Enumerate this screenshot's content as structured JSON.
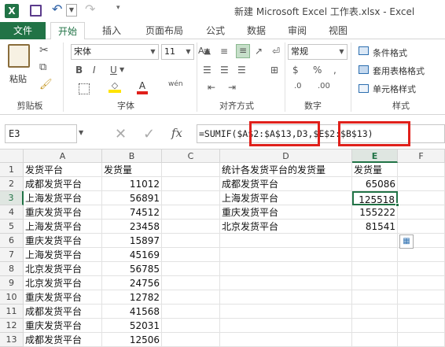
{
  "window": {
    "title": "新建 Microsoft Excel 工作表.xlsx - Excel",
    "app_icon": "excel-icon"
  },
  "tabs": [
    "文件",
    "开始",
    "插入",
    "页面布局",
    "公式",
    "数据",
    "审阅",
    "视图"
  ],
  "ribbon": {
    "clipboard": {
      "paste": "粘贴",
      "label": "剪贴板"
    },
    "font": {
      "name": "宋体",
      "size": "11",
      "label": "字体",
      "bold": "B",
      "italic": "I",
      "underline": "U",
      "font_color_label": "A",
      "phonetic": "wén"
    },
    "alignment": {
      "label": "对齐方式"
    },
    "number": {
      "format": "常规",
      "label": "数字"
    },
    "styles": {
      "conditional": "条件格式",
      "table": "套用表格格式",
      "cell": "单元格样式",
      "label": "样式"
    }
  },
  "formula_bar": {
    "name_box": "E3",
    "fx": "fx",
    "formula": "=SUMIF($A$2:$A$13,D3,$E$2:$B$13)",
    "part1": "=SUMIF(",
    "part2": "$A$2:$A$13",
    "part3": ",D3,",
    "part4": "$E$2:$B$13)"
  },
  "columns": [
    "A",
    "B",
    "C",
    "D",
    "E",
    "F"
  ],
  "rows": [
    "1",
    "2",
    "3",
    "4",
    "5",
    "6",
    "7",
    "8",
    "9",
    "10",
    "11",
    "12",
    "13"
  ],
  "sheet": {
    "colA": [
      "发货平台",
      "成都发货平台",
      "上海发货平台",
      "重庆发货平台",
      "上海发货平台",
      "重庆发货平台",
      "上海发货平台",
      "北京发货平台",
      "北京发货平台",
      "重庆发货平台",
      "成都发货平台",
      "重庆发货平台",
      "成都发货平台"
    ],
    "colB": [
      "发货量",
      "11012",
      "56891",
      "74512",
      "23458",
      "15897",
      "45169",
      "56785",
      "24756",
      "12782",
      "41568",
      "52031",
      "12506"
    ],
    "colD": [
      "统计各发货平台的发货量",
      "成都发货平台",
      "上海发货平台",
      "重庆发货平台",
      "北京发货平台"
    ],
    "colE": [
      "发货量",
      "65086",
      "125518",
      "155222",
      "81541"
    ]
  },
  "selected_cell": "E3",
  "colors": {
    "excel_green": "#217346",
    "highlight": "#e0201b"
  }
}
